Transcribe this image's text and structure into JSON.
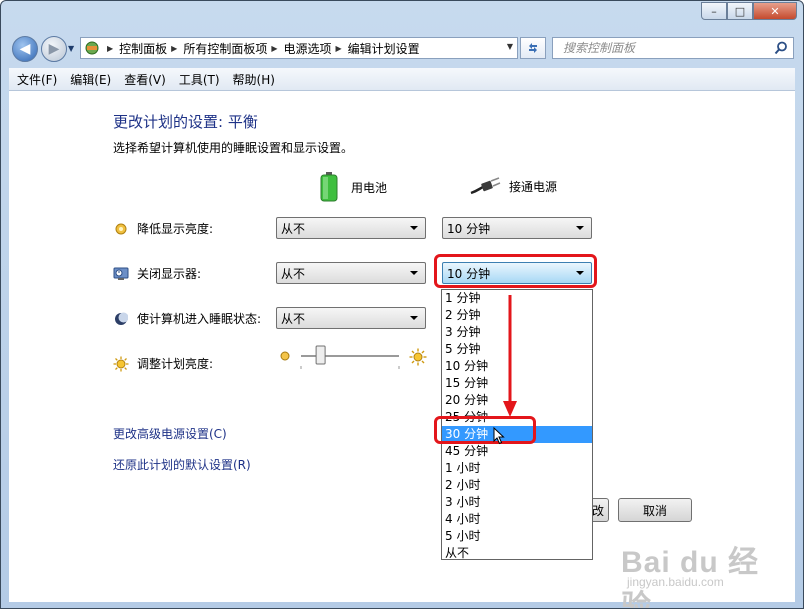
{
  "window": {
    "minimize": "–",
    "maximize": "□",
    "close": "✕"
  },
  "nav": {
    "back_icon": "back-arrow-icon",
    "forward_icon": "forward-arrow-icon"
  },
  "address": {
    "crumbs": [
      "控制面板",
      "所有控制面板项",
      "电源选项",
      "编辑计划设置"
    ],
    "icon": "control-panel-icon"
  },
  "search": {
    "placeholder": "搜索控制面板"
  },
  "menu": {
    "items": [
      "文件(F)",
      "编辑(E)",
      "查看(V)",
      "工具(T)",
      "帮助(H)"
    ]
  },
  "page": {
    "title": "更改计划的设置: 平衡",
    "subtitle": "选择希望计算机使用的睡眠设置和显示设置。"
  },
  "columns": {
    "battery": "用电池",
    "plugged": "接通电源"
  },
  "settings": [
    {
      "label": "降低显示亮度:",
      "battery": "从不",
      "plugged": "10 分钟"
    },
    {
      "label": "关闭显示器:",
      "battery": "从不",
      "plugged": "10 分钟"
    },
    {
      "label": "使计算机进入睡眠状态:",
      "battery": "从不"
    },
    {
      "label": "调整计划亮度:"
    }
  ],
  "brightness": {
    "battery_level": 0.2
  },
  "dropdown": {
    "options": [
      "1 分钟",
      "2 分钟",
      "3 分钟",
      "5 分钟",
      "10 分钟",
      "15 分钟",
      "20 分钟",
      "25 分钟",
      "30 分钟",
      "45 分钟",
      "1 小时",
      "2 小时",
      "3 小时",
      "4 小时",
      "5 小时",
      "从不"
    ],
    "selected": "30 分钟"
  },
  "links": {
    "advanced": "更改高级电源设置(C)",
    "restore": "还原此计划的默认设置(R)"
  },
  "buttons": {
    "save_partial": "改",
    "cancel": "取消"
  },
  "watermark": {
    "brand": "Bai du 经验",
    "url": "jingyan.baidu.com"
  },
  "colors": {
    "accent_title": "#1e3287",
    "highlight_red": "#e3161b",
    "selection_blue": "#3399ff"
  }
}
